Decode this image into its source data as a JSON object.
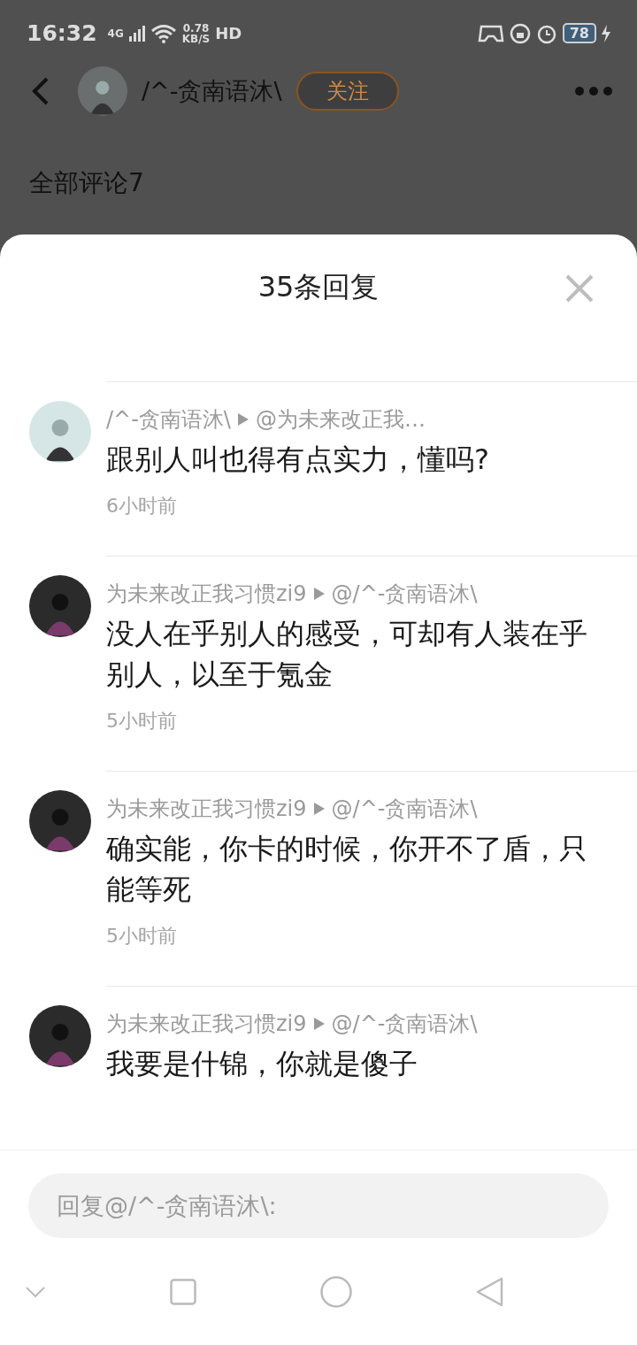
{
  "status_bar": {
    "time": "16:32",
    "network": "4G",
    "speed": "0.78",
    "speed_unit": "KB/S",
    "hd": "HD",
    "battery": "78"
  },
  "header": {
    "username": "/^-贪南语沐\\",
    "follow_button": "关注"
  },
  "comments_heading": "全部评论7",
  "sheet": {
    "title": "35条回复",
    "replies": [
      {
        "author": "/^-贪南语沐\\",
        "reply_to": "@为未来改正我…",
        "text": "跟别人叫也得有点实力，懂吗?",
        "time": "6小时前",
        "color": "#d6e6e6"
      },
      {
        "author": "为未来改正我习惯zi9",
        "reply_to": "@/^-贪南语沐\\",
        "text": "没人在乎别人的感受，可却有人装在乎别人，以至于氪金",
        "time": "5小时前",
        "color": "#2b2b2b"
      },
      {
        "author": "为未来改正我习惯zi9",
        "reply_to": "@/^-贪南语沐\\",
        "text": "确实能，你卡的时候，你开不了盾，只能等死",
        "time": "5小时前",
        "color": "#2b2b2b"
      },
      {
        "author": "为未来改正我习惯zi9",
        "reply_to": "@/^-贪南语沐\\",
        "text": "我要是什锦，你就是傻子",
        "color": "#2b2b2b"
      }
    ],
    "input": {
      "placeholder": "回复@/^-贪南语沐\\:"
    }
  }
}
